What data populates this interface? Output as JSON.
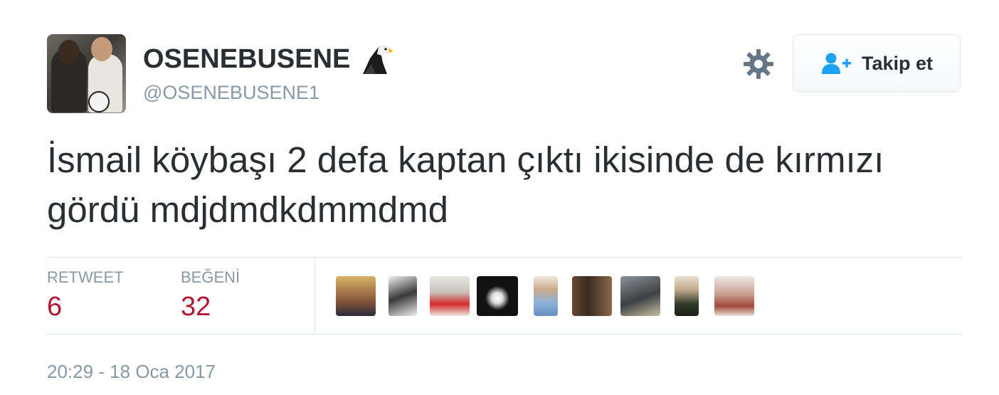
{
  "user": {
    "display_name": "OSENEBUSENE",
    "username": "@OSENEBUSENE1",
    "badge_icon": "eagle-icon"
  },
  "actions": {
    "settings_icon": "gear-icon",
    "follow_label": "Takip et",
    "follow_icon": "add-user-icon"
  },
  "tweet": {
    "text": "İsmail köybaşı 2 defa kaptan çıktı ikisinde de kırmızı gördü mdjdmdkdmmdmd"
  },
  "stats": {
    "retweet_label": "RETWEET",
    "retweet_count": "6",
    "like_label": "BEĞENİ",
    "like_count": "32"
  },
  "likers": [
    {
      "name": "liker-avatar-1",
      "color": "#c8a15a"
    },
    {
      "name": "liker-avatar-2",
      "color": "#3a3a3a"
    },
    {
      "name": "liker-avatar-3",
      "color": "#d32b2b"
    },
    {
      "name": "liker-avatar-4",
      "color": "#111111"
    },
    {
      "name": "liker-avatar-5",
      "color": "#8fb3d9"
    },
    {
      "name": "liker-avatar-6",
      "color": "#5a4030"
    },
    {
      "name": "liker-avatar-7",
      "color": "#505a60"
    },
    {
      "name": "liker-avatar-8",
      "color": "#2f3a2a"
    },
    {
      "name": "liker-avatar-9",
      "color": "#a04a3a"
    }
  ],
  "timestamp": "20:29 - 18 Oca 2017",
  "colors": {
    "accent": "#1da1f2",
    "like_count": "#b01735",
    "muted": "#8899a6"
  }
}
